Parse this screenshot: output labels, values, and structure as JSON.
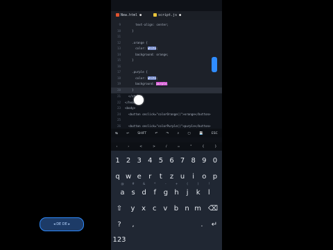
{
  "tabs": [
    {
      "label": "New.html",
      "active": true,
      "close": "●"
    },
    {
      "label": "script.js",
      "active": false,
      "close": "●"
    }
  ],
  "editor": {
    "lines": [
      {
        "n": "9",
        "code": "      text-align: center;"
      },
      {
        "n": "10",
        "code": "    }"
      },
      {
        "n": "11",
        "code": ""
      },
      {
        "n": "12",
        "code": "    .orange {"
      },
      {
        "n": "13",
        "code": "      color: ",
        "hl": "white",
        "hltype": "white"
      },
      {
        "n": "14",
        "code": "      background: orange;"
      },
      {
        "n": "15",
        "code": "    }"
      },
      {
        "n": "16",
        "code": ""
      },
      {
        "n": "17",
        "code": "    .purple {"
      },
      {
        "n": "18",
        "code": "      color: ",
        "hl": "white",
        "hltype": "white"
      },
      {
        "n": "19",
        "code": "      background: ",
        "hl": "purple",
        "hltype": "purple"
      },
      {
        "n": "20",
        "code": "    }",
        "current": true
      }
    ],
    "lower_lines": [
      {
        "n": "21",
        "code": "  </style>"
      },
      {
        "n": "22",
        "code": "</head>"
      },
      {
        "n": "23",
        "code": "<body>"
      },
      {
        "n": "24",
        "code": "  <button onclick=\"colorOrange()\">orange</button>"
      },
      {
        "n": "25",
        "code": ""
      },
      {
        "n": "26",
        "code": "  <button onclick=\"colorPurple()\">purple</button>"
      }
    ]
  },
  "extra_keys_row1": [
    "↹",
    "↩",
    "SHIFT",
    "↶",
    "↷",
    "⌕",
    "▢",
    "💾",
    "ESC"
  ],
  "extra_keys_row2": [
    "‹",
    "›",
    "<",
    ">",
    "/",
    "=",
    "\"",
    "{",
    "}"
  ],
  "keyboard": {
    "row_numbers": [
      "1",
      "2",
      "3",
      "4",
      "5",
      "6",
      "7",
      "8",
      "9",
      "0"
    ],
    "row1": [
      {
        "k": "q",
        "s": ""
      },
      {
        "k": "w",
        "s": ""
      },
      {
        "k": "e",
        "s": ""
      },
      {
        "k": "r",
        "s": ""
      },
      {
        "k": "t",
        "s": ""
      },
      {
        "k": "z",
        "s": ""
      },
      {
        "k": "u",
        "s": ""
      },
      {
        "k": "i",
        "s": ""
      },
      {
        "k": "o",
        "s": ""
      },
      {
        "k": "p",
        "s": ""
      }
    ],
    "row2": [
      {
        "k": "a",
        "s": "@"
      },
      {
        "k": "s",
        "s": "#"
      },
      {
        "k": "d",
        "s": "&"
      },
      {
        "k": "f",
        "s": "*"
      },
      {
        "k": "g",
        "s": "-"
      },
      {
        "k": "h",
        "s": "+"
      },
      {
        "k": "j",
        "s": "("
      },
      {
        "k": "k",
        "s": ")"
      },
      {
        "k": "l",
        "s": "!"
      }
    ],
    "row3": [
      {
        "k": "y",
        "s": ""
      },
      {
        "k": "x",
        "s": ""
      },
      {
        "k": "c",
        "s": ""
      },
      {
        "k": "v",
        "s": ""
      },
      {
        "k": "b",
        "s": ""
      },
      {
        "k": "n",
        "s": ""
      },
      {
        "k": "m",
        "s": ""
      }
    ],
    "shift": "⇧",
    "backspace": "⌫",
    "symbols": "?123",
    "comma": ",",
    "period": ".",
    "enter": "↵",
    "space_label": "◂ DE DE ▸"
  }
}
